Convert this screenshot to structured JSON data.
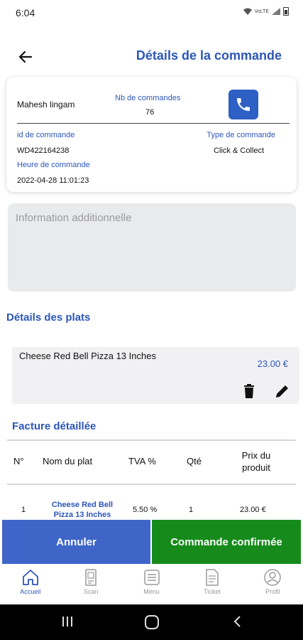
{
  "status_bar": {
    "time": "6:04",
    "network": "VoLTE"
  },
  "header": {
    "title": "Détails de la commande"
  },
  "order_card": {
    "customer_name": "Mahesh lingam",
    "orders_count_label": "Nb de commandes",
    "orders_count_value": "76",
    "order_id_label": "id de commande",
    "order_id_value": "WD422164238",
    "order_type_label": "Type de commande",
    "order_type_value": "Click & Collect",
    "order_time_label": "Heure de commande",
    "order_time_value": "2022-04-28 11:01:23"
  },
  "additional_info": {
    "placeholder": "Information additionnelle"
  },
  "dishes_section": {
    "title": "Détails des plats",
    "items": [
      {
        "name": "Cheese Red Bell Pizza 13 Inches",
        "price": "23.00 €"
      }
    ]
  },
  "invoice": {
    "title": "Facture détaillée",
    "headers": [
      "N°",
      "Nom du plat",
      "TVA %",
      "Qté",
      "Prix du produit"
    ],
    "rows": [
      {
        "no": "1",
        "dish": "Cheese Red Bell Pizza 13 Inches",
        "tva": "5.50 %",
        "qty": "1",
        "price": "23.00 €"
      }
    ]
  },
  "actions": {
    "cancel_label": "Annuler",
    "confirm_label": "Commande confirmée"
  },
  "bottom_nav": {
    "items": [
      {
        "label": "Accueil",
        "icon": "home-icon",
        "active": true
      },
      {
        "label": "Scan",
        "icon": "scan-icon",
        "active": false
      },
      {
        "label": "Menu",
        "icon": "menu-icon",
        "active": false
      },
      {
        "label": "Ticket",
        "icon": "ticket-icon",
        "active": false
      },
      {
        "label": "Profil",
        "icon": "profile-icon",
        "active": false
      }
    ]
  },
  "colors": {
    "accent": "#2c56b8",
    "cancel": "#3f65c8",
    "confirm": "#168b1b",
    "nav_inactive": "#999999"
  }
}
